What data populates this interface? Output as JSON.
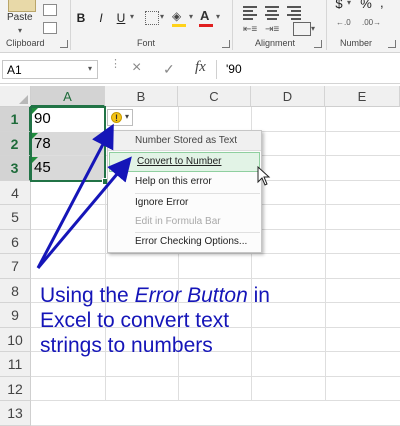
{
  "ribbon": {
    "paste_label": "Paste",
    "clipboard_label": "Clipboard",
    "font_label": "Font",
    "alignment_label": "Alignment",
    "number_label": "Number",
    "bold": "B",
    "italic": "I",
    "underline": "U",
    "currency": "$",
    "percent": "%",
    "font_color": "#e02020",
    "highlight_color": "#ffd21a"
  },
  "formula_bar": {
    "name_box": "A1",
    "cancel_icon": "×",
    "enter_icon": "✓",
    "fx_label": "fx",
    "formula": "'90"
  },
  "grid": {
    "columns": [
      "A",
      "B",
      "C",
      "D",
      "E"
    ],
    "rows": [
      "1",
      "2",
      "3",
      "4",
      "5",
      "6",
      "7",
      "8",
      "9",
      "10",
      "11",
      "12",
      "13"
    ],
    "cells": {
      "A1": "90",
      "A2": "78",
      "A3": "45"
    }
  },
  "error_menu": {
    "header": "Number Stored as Text",
    "items": [
      {
        "label": "Convert to Number",
        "state": "hover"
      },
      {
        "label": "Help on this error",
        "state": "normal"
      },
      {
        "label": "Ignore Error",
        "state": "normal"
      },
      {
        "label": "Edit in Formula Bar",
        "state": "disabled"
      },
      {
        "label": "Error Checking Options...",
        "state": "normal"
      }
    ]
  },
  "annotation": {
    "part1": "Using the ",
    "emph1": "Error Button",
    "part2": " in Excel to convert text strings to numbers",
    "color": "#1515b8"
  }
}
